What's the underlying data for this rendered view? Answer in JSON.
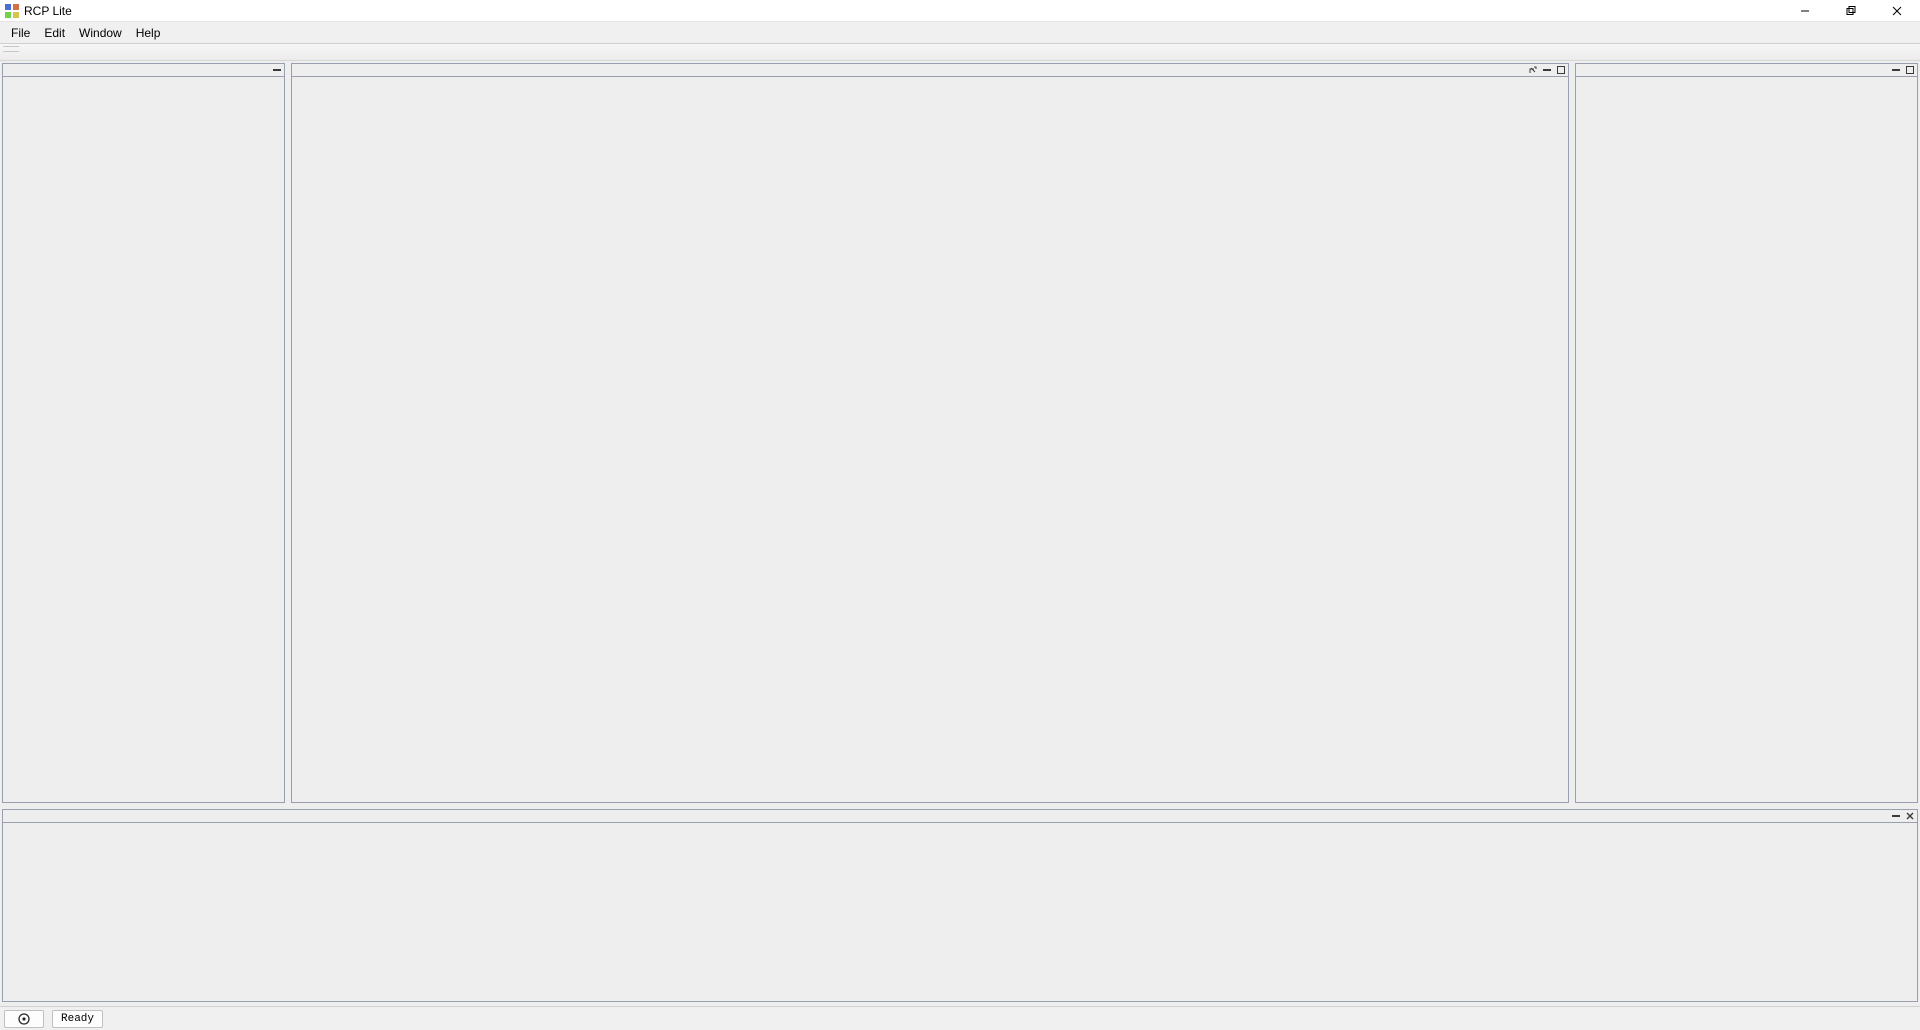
{
  "window": {
    "title": "RCP Lite"
  },
  "menubar": {
    "items": [
      "File",
      "Edit",
      "Window",
      "Help"
    ]
  },
  "statusbar": {
    "text": "Ready"
  },
  "icons": {
    "app": "app-icon",
    "minimize": "minimize-icon",
    "maximize": "maximize-icon",
    "close": "close-icon",
    "pane_minimize": "pane-minimize-icon",
    "pane_maximize": "pane-maximize-icon",
    "pane_restore": "pane-restore-icon",
    "pane_close": "pane-close-icon",
    "status": "running-icon"
  }
}
